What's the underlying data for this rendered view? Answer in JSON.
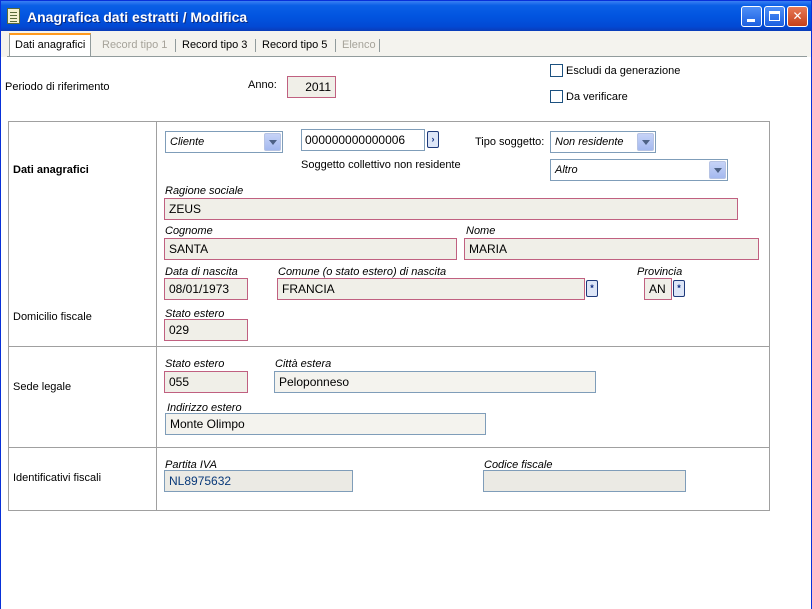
{
  "window": {
    "title": "Anagrafica dati estratti / Modifica"
  },
  "tabs": [
    {
      "label": "Dati anagrafici"
    },
    {
      "label": "Record tipo 1"
    },
    {
      "label": "Record tipo 3"
    },
    {
      "label": "Record tipo 5"
    },
    {
      "label": "Elenco"
    }
  ],
  "header": {
    "periodo_label": "Periodo di riferimento",
    "anno_label": "Anno:",
    "anno_value": "2011",
    "escludi_label": "Escludi da generazione",
    "verificare_label": "Da verificare"
  },
  "sections": {
    "dati_anagrafici": "Dati anagrafici",
    "domicilio_fiscale": "Domicilio fiscale",
    "sede_legale": "Sede legale",
    "identificativi_fiscali": "Identificativi fiscali"
  },
  "anagrafica": {
    "tipo_conto": "Cliente",
    "codice": "000000000000006",
    "tipo_soggetto_label": "Tipo soggetto:",
    "tipo_soggetto": "Non residente",
    "soggetto_collettivo": "Soggetto collettivo non residente",
    "altro": "Altro",
    "ragione_sociale_label": "Ragione sociale",
    "ragione_sociale": "ZEUS",
    "cognome_label": "Cognome",
    "cognome": "SANTA",
    "nome_label": "Nome",
    "nome": "MARIA",
    "data_nascita_label": "Data di nascita",
    "data_nascita": "08/01/1973",
    "comune_label": "Comune (o stato estero) di nascita",
    "comune": "FRANCIA",
    "provincia_label": "Provincia",
    "provincia": "AN"
  },
  "domicilio": {
    "stato_estero_label": "Stato estero",
    "stato_estero": "029"
  },
  "sede": {
    "stato_estero_label": "Stato estero",
    "stato_estero": "055",
    "citta_label": "Città estera",
    "citta": "Peloponneso",
    "indirizzo_label": "Indirizzo estero",
    "indirizzo": "Monte Olimpo"
  },
  "identificativi": {
    "partita_iva_label": "Partita IVA",
    "partita_iva": "NL8975632",
    "codice_fiscale_label": "Codice fiscale",
    "codice_fiscale": ""
  }
}
